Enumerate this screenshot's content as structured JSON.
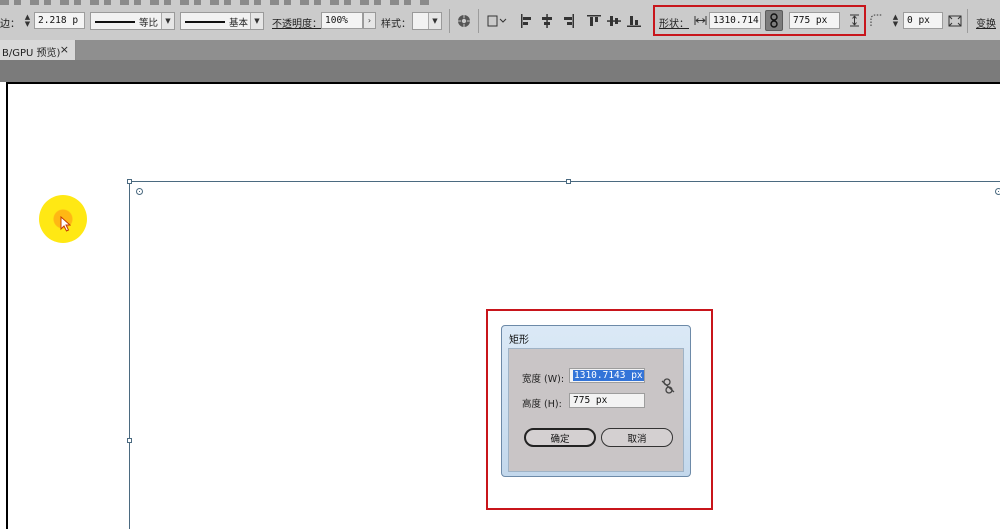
{
  "control_bar": {
    "stroke_label": "边：",
    "stroke_weight": "2.218 p",
    "stroke_profile_label": "等比",
    "brush_label": "基本",
    "opacity_label": "不透明度：",
    "opacity_value": "100%",
    "style_label": "样式：",
    "shape_label": "形状：",
    "width_value": "1310.714 p",
    "height_value": "775 px",
    "corner_value": "0 px",
    "transform_label": "变换"
  },
  "document_tab": {
    "title": "B/GPU 预览)",
    "close_glyph": "×"
  },
  "dialog": {
    "title": "矩形",
    "width_label": "宽度 (W):",
    "width_value": "1310.7143 px",
    "height_label": "高度 (H):",
    "height_value": "775 px",
    "ok_label": "确定",
    "cancel_label": "取消"
  },
  "colors": {
    "highlight": "#c8151b",
    "selection": "#4b6a80",
    "text_selection": "#3374d8"
  }
}
